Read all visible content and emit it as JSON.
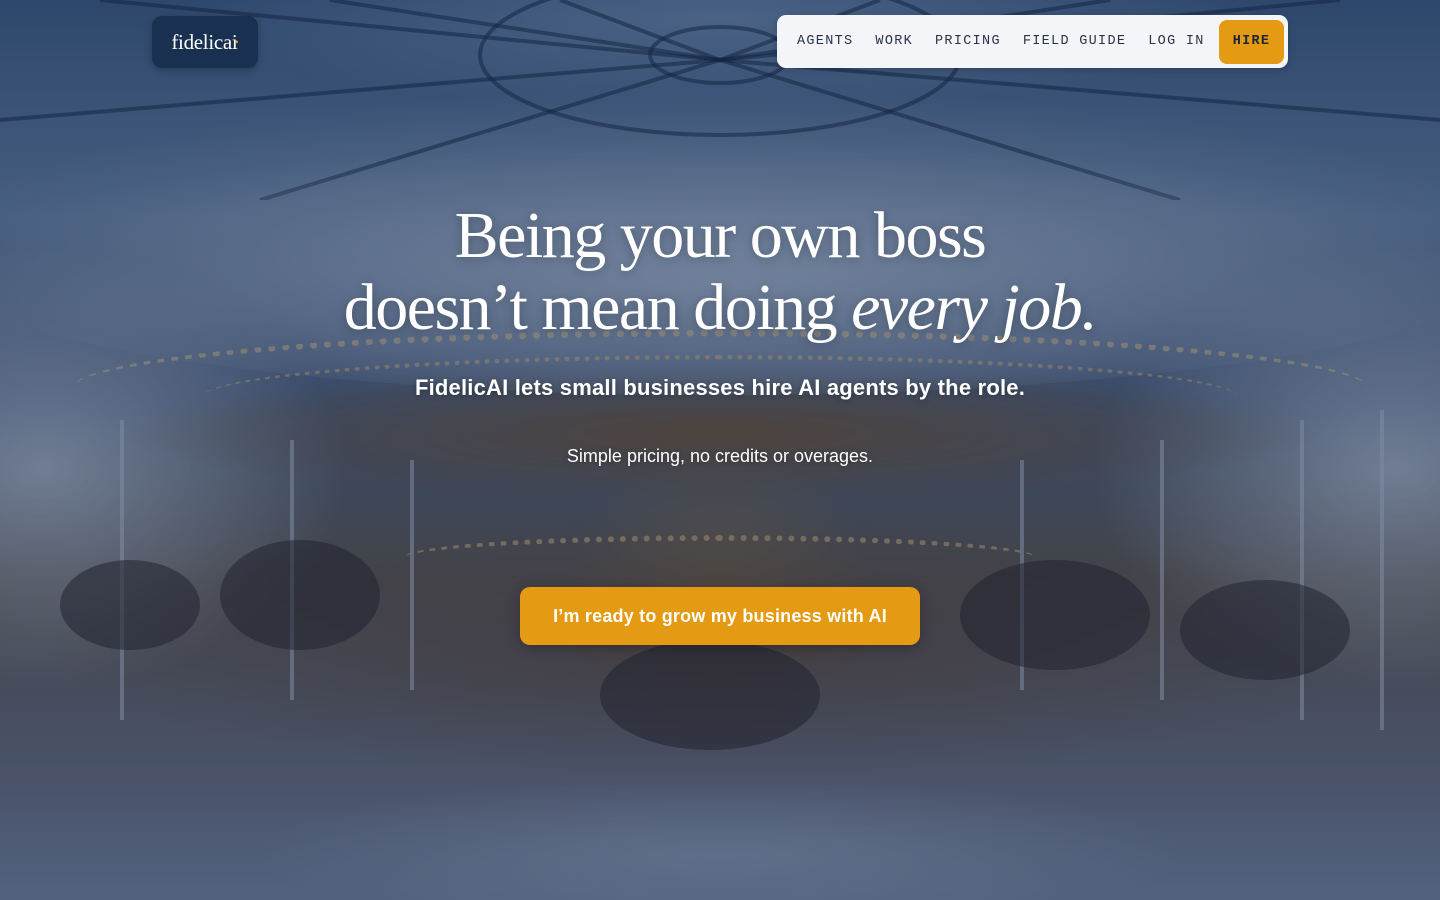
{
  "brand": {
    "name": "fidelic",
    "suffix": "ai"
  },
  "nav": {
    "links": [
      {
        "label": "AGENTS"
      },
      {
        "label": "WORK"
      },
      {
        "label": "PRICING"
      },
      {
        "label": "FIELD GUIDE"
      },
      {
        "label": "LOG IN"
      }
    ],
    "hire_label": "HIRE"
  },
  "hero": {
    "headline_line1": "Being your own boss",
    "headline_line2_prefix": "doesn’t mean doing ",
    "headline_line2_emphasis": "every job.",
    "subhead": "FidelicAI lets small businesses hire AI agents by the role.",
    "tagline": "Simple pricing, no credits or overages.",
    "cta_label": "I’m ready to grow my business with AI"
  },
  "colors": {
    "accent": "#e49a12",
    "nav_background": "#f3f5f9",
    "logo_background": "#1a3050",
    "overlay": "#182c4e"
  }
}
